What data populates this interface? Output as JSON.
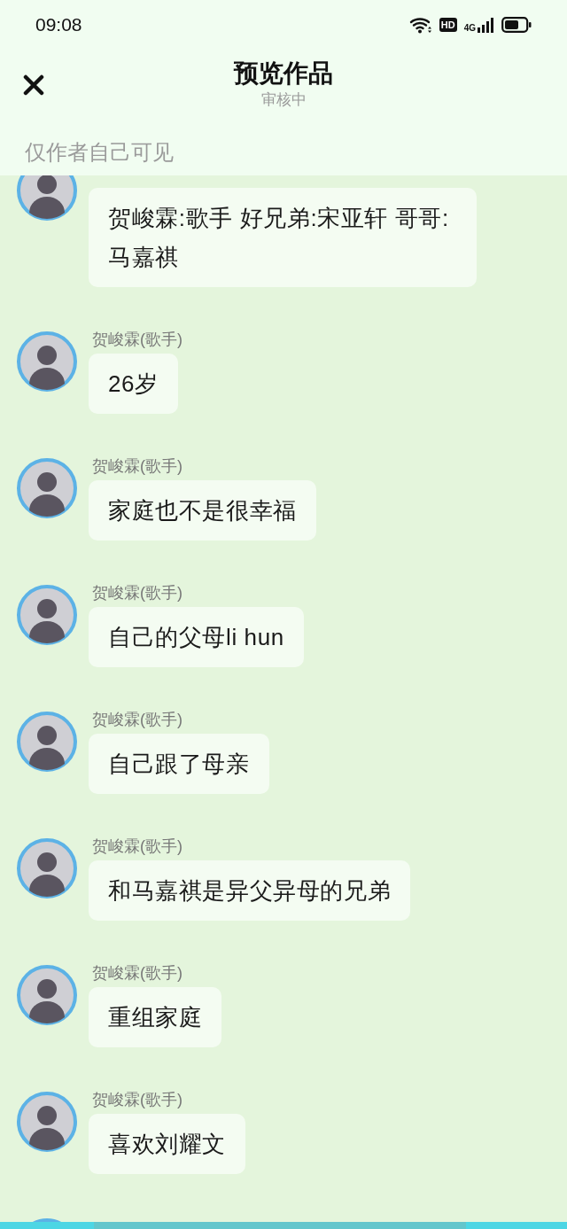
{
  "status_bar": {
    "time": "09:08",
    "hd": "HD",
    "network": "4G"
  },
  "header": {
    "title": "预览作品",
    "subtitle": "审核中"
  },
  "notice": "仅作者自己可见",
  "messages": [
    {
      "text": "贺峻霖:歌手 好兄弟:宋亚轩 哥哥:马嘉祺"
    },
    {
      "author": "贺峻霖(歌手)",
      "text": "26岁"
    },
    {
      "author": "贺峻霖(歌手)",
      "text": "家庭也不是很幸福"
    },
    {
      "author": "贺峻霖(歌手)",
      "text": "自己的父母li hun"
    },
    {
      "author": "贺峻霖(歌手)",
      "text": "自己跟了母亲"
    },
    {
      "author": "贺峻霖(歌手)",
      "text": "和马嘉祺是异父异母的兄弟"
    },
    {
      "author": "贺峻霖(歌手)",
      "text": "重组家庭"
    },
    {
      "author": "贺峻霖(歌手)",
      "text": "喜欢刘耀文"
    }
  ],
  "more_below": true
}
